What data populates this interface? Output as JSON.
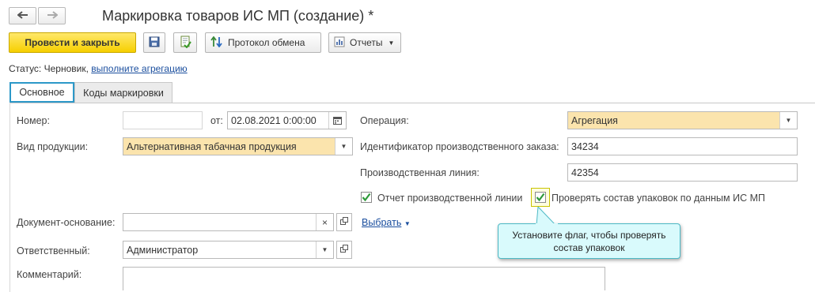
{
  "window": {
    "title": "Маркировка товаров ИС МП (создание) *"
  },
  "toolbar": {
    "post_close_label": "Провести и закрыть",
    "exchange_protocol_label": "Протокол обмена",
    "reports_label": "Отчеты"
  },
  "status": {
    "prefix": "Статус:",
    "value": "Черновик,",
    "link": "выполните агрегацию"
  },
  "tabs": [
    {
      "label": "Основное",
      "active": true
    },
    {
      "label": "Коды маркировки",
      "active": false
    }
  ],
  "form": {
    "number_label": "Номер:",
    "number_value": "",
    "from_label": "от:",
    "date_value": "02.08.2021  0:00:00",
    "product_type_label": "Вид продукции:",
    "product_type_value": "Альтернативная табачная продукция",
    "operation_label": "Операция:",
    "operation_value": "Агрегация",
    "prod_order_label": "Идентификатор производственного заказа:",
    "prod_order_value": "34234",
    "prod_line_label": "Производственная линия:",
    "prod_line_value": "42354",
    "line_report_label": "Отчет производственной линии",
    "line_report_checked": true,
    "check_packages_label": "Проверять состав упаковок по данным ИС МП",
    "check_packages_checked": true,
    "base_doc_label": "Документ-основание:",
    "base_doc_value": "",
    "select_label": "Выбрать",
    "responsible_label": "Ответственный:",
    "responsible_value": "Администратор",
    "comment_label": "Комментарий:",
    "comment_value": ""
  },
  "tooltip": {
    "text": "Установите флаг, чтобы проверять состав упаковок"
  },
  "colors": {
    "accent": "#2c98c8",
    "primary_button": "#f6cf00",
    "highlight_field": "#fbe4ad",
    "tooltip_bg": "#d9fafc",
    "checkmark": "#2e9a3a"
  }
}
